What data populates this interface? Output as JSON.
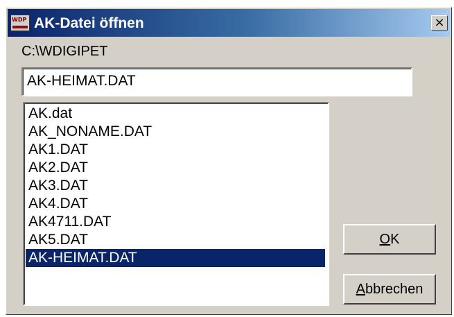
{
  "window": {
    "title": "AK-Datei öffnen",
    "icon_text": "WDP",
    "close_glyph": "×"
  },
  "path": "C:\\WDIGIPET",
  "filename_value": "AK-HEIMAT.DAT",
  "files": [
    "AK.dat",
    "AK_NONAME.DAT",
    "AK1.DAT",
    "AK2.DAT",
    "AK3.DAT",
    "AK4.DAT",
    "AK4711.DAT",
    "AK5.DAT",
    "AK-HEIMAT.DAT"
  ],
  "selected_index": 8,
  "buttons": {
    "ok_mnemonic": "O",
    "ok_rest": "K",
    "cancel_mnemonic": "A",
    "cancel_rest": "bbrechen"
  },
  "colors": {
    "selection": "#0a246a",
    "titlebar_start": "#0a246a",
    "titlebar_end": "#a6caf0",
    "dialog_face": "#d4d0c8"
  }
}
